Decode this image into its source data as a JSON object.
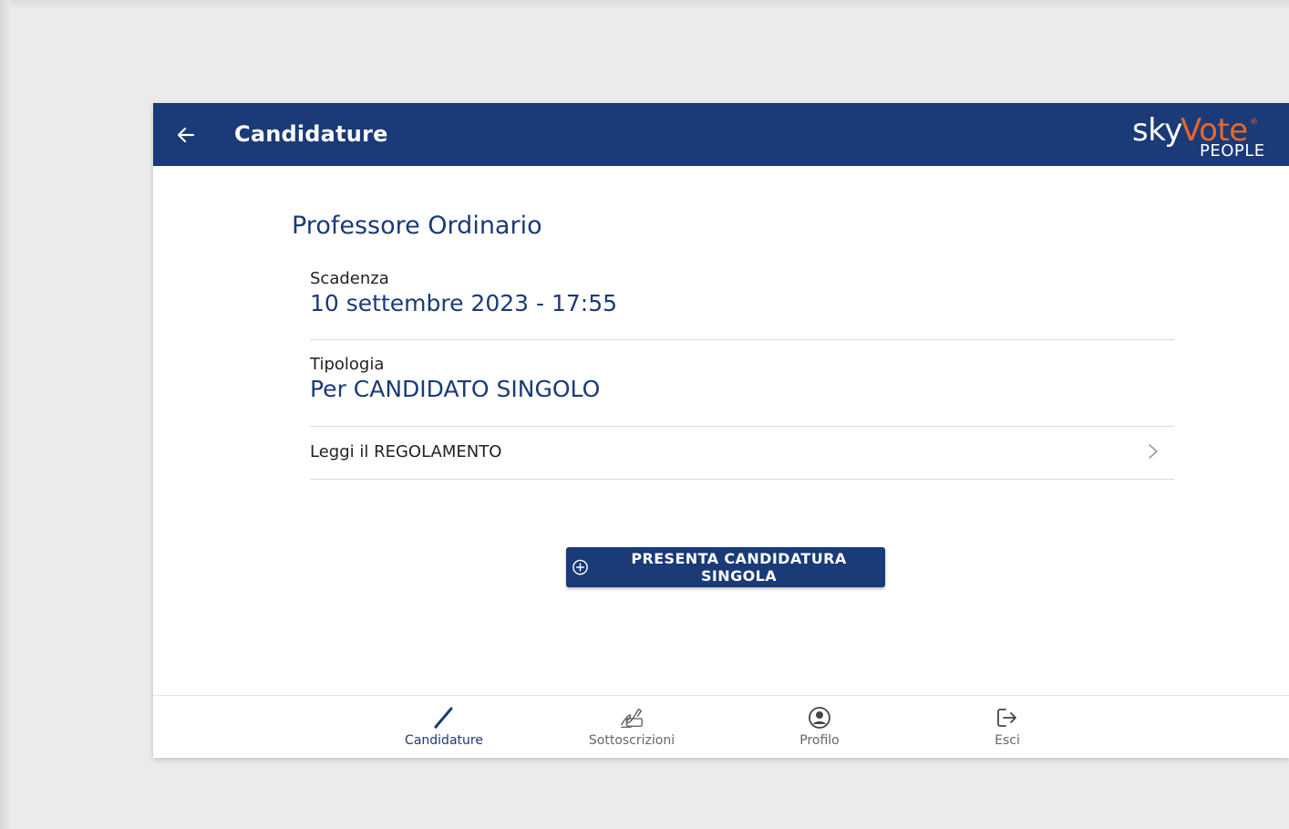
{
  "appbar": {
    "title": "Candidature",
    "logo": {
      "sky": "sky",
      "vote": "Vote",
      "reg": "®",
      "people": "PEOPLE"
    }
  },
  "section": {
    "title": "Professore Ordinario",
    "scadenza": {
      "label": "Scadenza",
      "value": "10 settembre 2023 - 17:55"
    },
    "tipologia": {
      "label": "Tipologia",
      "value": "Per CANDIDATO SINGOLO"
    },
    "regolamento": {
      "label": "Leggi il REGOLAMENTO"
    }
  },
  "action": {
    "label": "PRESENTA CANDIDATURA SINGOLA",
    "icon": "add-circle-icon"
  },
  "nav": {
    "items": [
      {
        "label": "Candidature",
        "icon": "pencil-icon",
        "active": true
      },
      {
        "label": "Sottoscrizioni",
        "icon": "signature-icon",
        "active": false
      },
      {
        "label": "Profilo",
        "icon": "profile-icon",
        "active": false
      },
      {
        "label": "Esci",
        "icon": "logout-icon",
        "active": false
      }
    ]
  },
  "colors": {
    "primary": "#1a3a78",
    "accent": "#e8672a"
  }
}
